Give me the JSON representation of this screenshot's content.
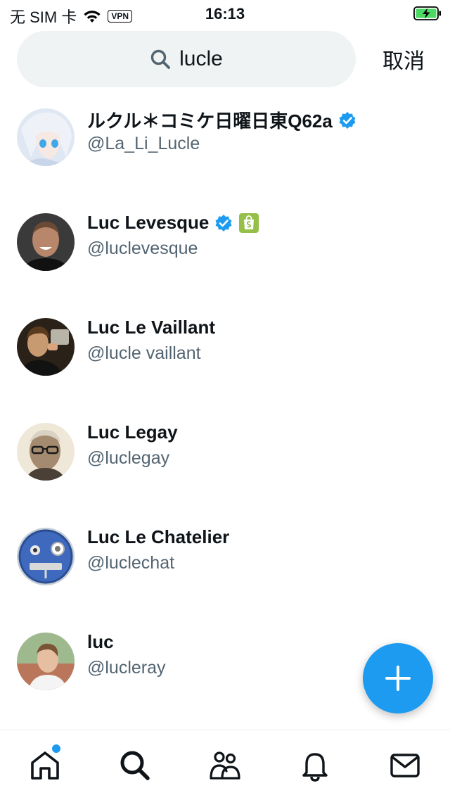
{
  "status_bar": {
    "carrier": "无 SIM 卡",
    "vpn": "VPN",
    "time": "16:13"
  },
  "search": {
    "query": "lucle",
    "cancel_label": "取消"
  },
  "results": [
    {
      "name": "ルクル＊コミケ日曜日東Q62a",
      "handle": "@La_Li_Lucle",
      "verified": true
    },
    {
      "name": "Luc Levesque",
      "handle": "@luclevesque",
      "verified": true,
      "shop_badge": true
    },
    {
      "name": "Luc Le Vaillant",
      "handle": "@lucle vaillant",
      "verified": false
    },
    {
      "name": "Luc Legay",
      "handle": "@luclegay",
      "verified": false
    },
    {
      "name": "Luc Le Chatelier",
      "handle": "@luclechat",
      "verified": false
    },
    {
      "name": "luc",
      "handle": "@lucleray",
      "verified": false
    }
  ],
  "colors": {
    "accent": "#1d9bf0",
    "search_bg": "#eff3f4",
    "handle": "#536471",
    "text": "#0f1419"
  },
  "icons": {
    "fab": "plus-icon",
    "nav": [
      "home-icon",
      "search-icon",
      "communities-icon",
      "notifications-icon",
      "messages-icon"
    ]
  }
}
